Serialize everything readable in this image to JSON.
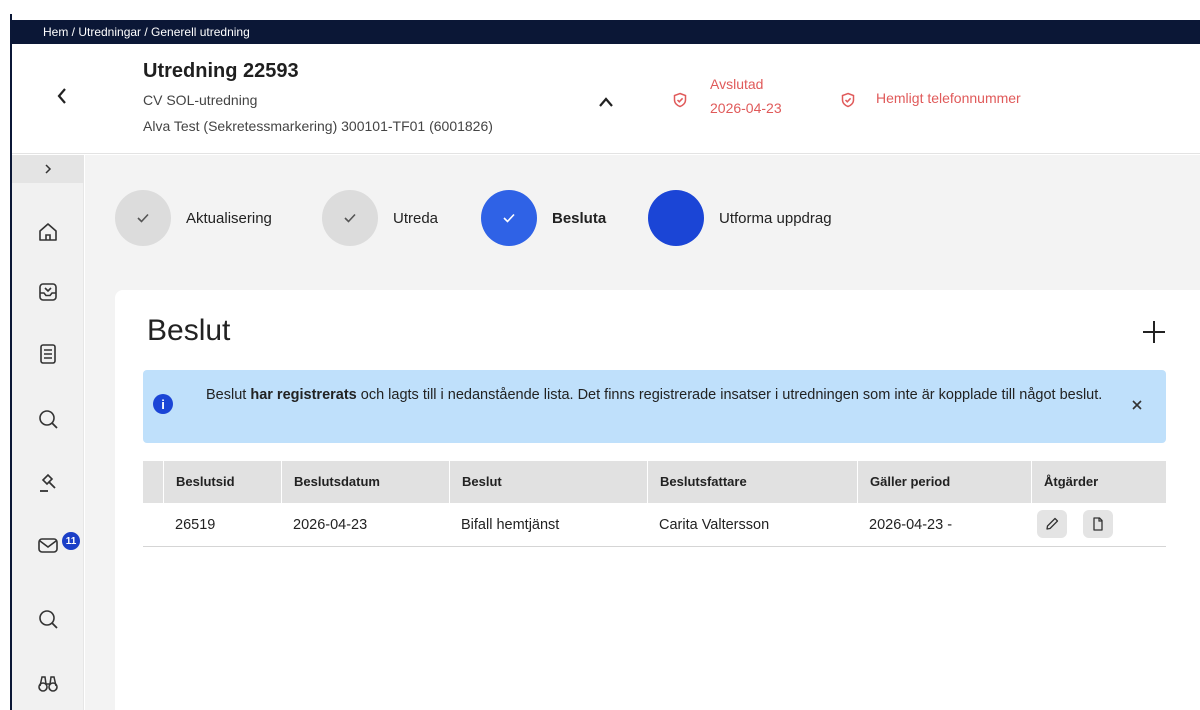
{
  "breadcrumb": "Hem / Utredningar / Generell utredning",
  "header": {
    "title": "Utredning 22593",
    "subtitle": "CV SOL-utredning",
    "person": "Alva Test (Sekretessmarkering) 300101-TF01 (6001826)",
    "status_label": "Avslutad",
    "status_date": "2026-04-23",
    "flag_label": "Hemligt telefonnummer"
  },
  "sidebar": {
    "mail_badge": "11",
    "icons": [
      "home-icon",
      "inbox-icon",
      "document-icon",
      "search-icon",
      "gavel-icon",
      "mail-icon",
      "search-icon",
      "binoculars-icon"
    ]
  },
  "steps": [
    {
      "label": "Aktualisering",
      "state": "done"
    },
    {
      "label": "Utreda",
      "state": "done"
    },
    {
      "label": "Besluta",
      "state": "active"
    },
    {
      "label": "Utforma uppdrag",
      "state": "next"
    }
  ],
  "card": {
    "title": "Beslut"
  },
  "alert": {
    "pre": "Beslut ",
    "strong": "har registrerats",
    "post": " och lagts till i nedanstående lista. Det finns registrerade insatser i utredningen som inte är kopplade till något beslut."
  },
  "table": {
    "columns": [
      "Beslutsid",
      "Beslutsdatum",
      "Beslut",
      "Beslutsfattare",
      "Gäller period",
      "Åtgärder"
    ],
    "rows": [
      {
        "id": "26519",
        "date": "2026-04-23",
        "decision": "Bifall hemtjänst",
        "maker": "Carita Valtersson",
        "period": "2026-04-23 -"
      }
    ]
  },
  "colors": {
    "nav_dark": "#0b1736",
    "accent_blue": "#1b45d6",
    "step_active": "#2f62e6",
    "status_red": "#e05a5a",
    "alert_bg": "#bfe0fb"
  }
}
